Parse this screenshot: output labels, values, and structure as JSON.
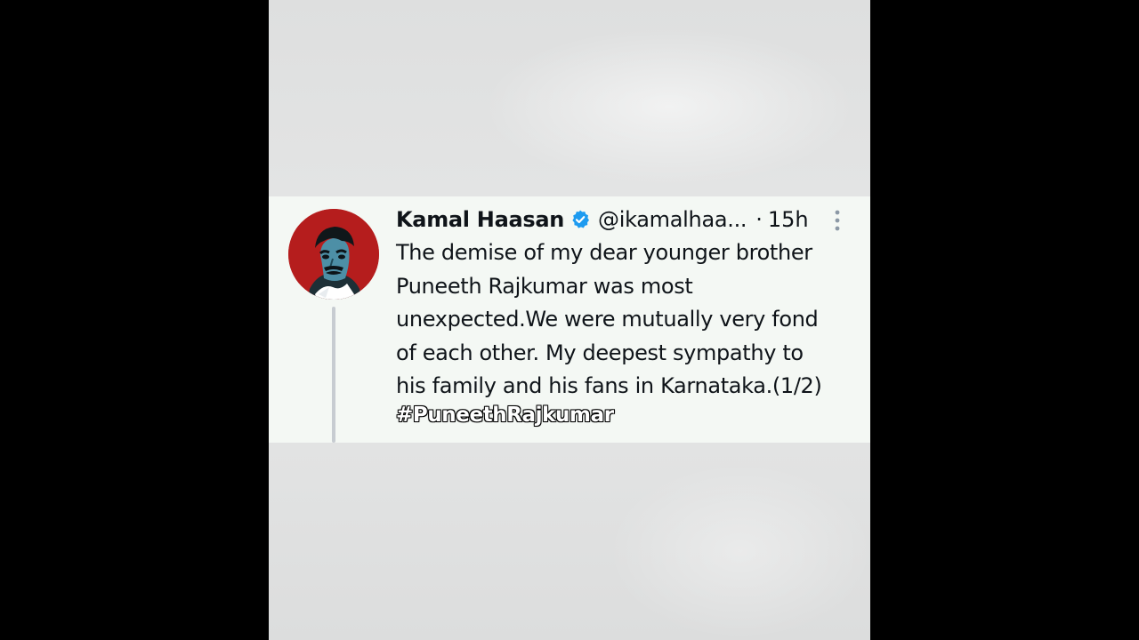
{
  "tweet": {
    "author_name": "Kamal Haasan",
    "handle": "@ikamalhaa...",
    "separator": "·",
    "timestamp": "15h",
    "verified": true,
    "avatar_icon": "profile-photo",
    "more_icon": "more-vertical-icon",
    "text": "The demise of my dear younger brother\nPuneeth Rajkumar  was most\nunexpected.We were mutually very fond\nof each other. My deepest sympathy to\nhis family and his fans in Karnataka.(1/2)",
    "hashtag": "#PuneethRajkumar"
  },
  "colors": {
    "card_background": "#f4f8f4",
    "verified_badge": "#1d9bf0",
    "avatar_background": "#b51d1d",
    "thread_line": "#c7ccd1",
    "text": "#0f1419"
  }
}
